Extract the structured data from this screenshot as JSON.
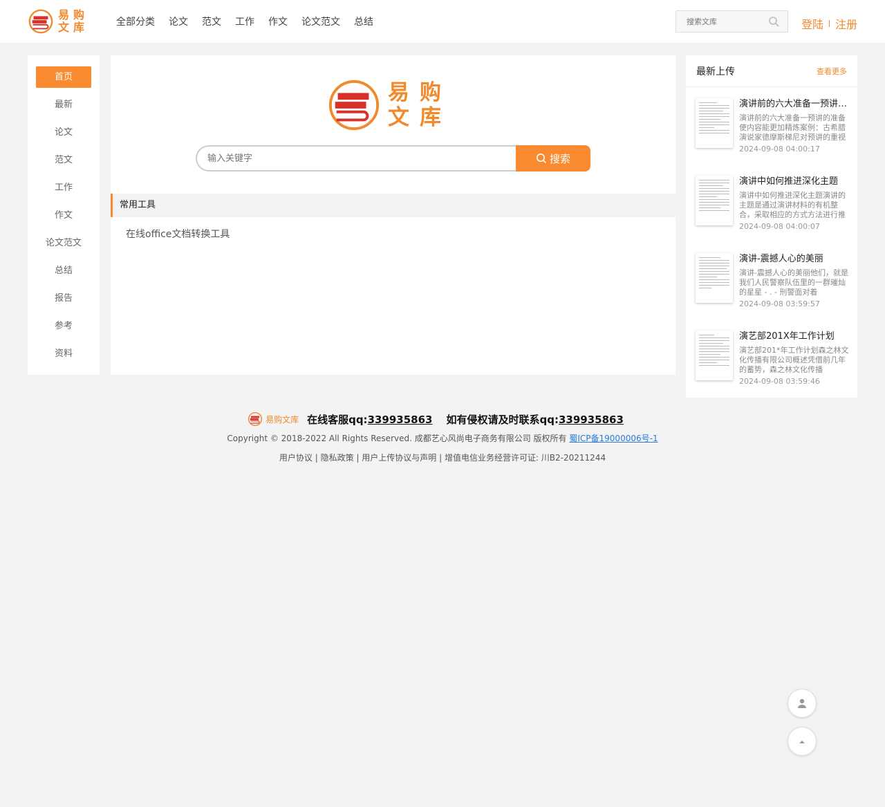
{
  "header": {
    "logo_text": [
      "易",
      "购",
      "文",
      "库"
    ],
    "nav": [
      "全部分类",
      "论文",
      "范文",
      "工作",
      "作文",
      "论文范文",
      "总结"
    ],
    "search_placeholder": "搜索文库",
    "login": "登陆",
    "register": "注册"
  },
  "leftnav": [
    "首页",
    "最新",
    "论文",
    "范文",
    "工作",
    "作文",
    "论文范文",
    "总结",
    "报告",
    "参考",
    "资料"
  ],
  "hero": {
    "logo_text": [
      "易",
      "购",
      "文",
      "库"
    ],
    "search_placeholder": "输入关键字",
    "search_button": "搜索"
  },
  "tools": {
    "heading": "常用工具",
    "items": [
      "在线office文档转换工具"
    ]
  },
  "latest": {
    "title": "最新上传",
    "more": "查看更多",
    "docs": [
      {
        "title": "演讲前的六大准备一预讲的准备使内容能更加精炼案例",
        "desc": "演讲前的六大准备一预讲的准备使内容能更加精炼案例：古希腊演说家德摩斯梯尼对预讲的重视",
        "time": "2024-09-08 04:00:17"
      },
      {
        "title": "演讲中如何推进深化主题",
        "desc": "演讲中如何推进深化主题演讲的主题是通过演讲材料的有机整合，采取相应的方式方法进行推进",
        "time": "2024-09-08 04:00:07"
      },
      {
        "title": "演讲-震撼人心的美丽",
        "desc": "演讲-震撼人心的美丽他们，就是我们人民警察队伍里的一群璀灿的星星 - . - 刑警面对着",
        "time": "2024-09-08 03:59:57"
      },
      {
        "title": "演艺部201X年工作计划",
        "desc": "演艺部201*年工作计划森之林文化传播有限公司概述凭借前几年的蓄势，森之林文化传播",
        "time": "2024-09-08 03:59:46"
      }
    ]
  },
  "footer": {
    "logo": "易购文库",
    "service_label": "在线客服qq:",
    "service_qq": "339935863",
    "infringe_label": "如有侵权请及时联系qq:",
    "infringe_qq": "339935863",
    "copyright": "Copyright © 2018-2022 All Rights Reserved. 成都艺心风尚电子商务有限公司 版权所有",
    "icp": "蜀ICP备19000006号-1",
    "links": "用户协议 | 隐私政策 | 用户上传协议与声明 | 增值电信业务经营许可证: 川B2-20211244"
  },
  "colors": {
    "accent": "#f98a2f",
    "brand": "#f08a2c",
    "logo_red": "#d9312a"
  }
}
